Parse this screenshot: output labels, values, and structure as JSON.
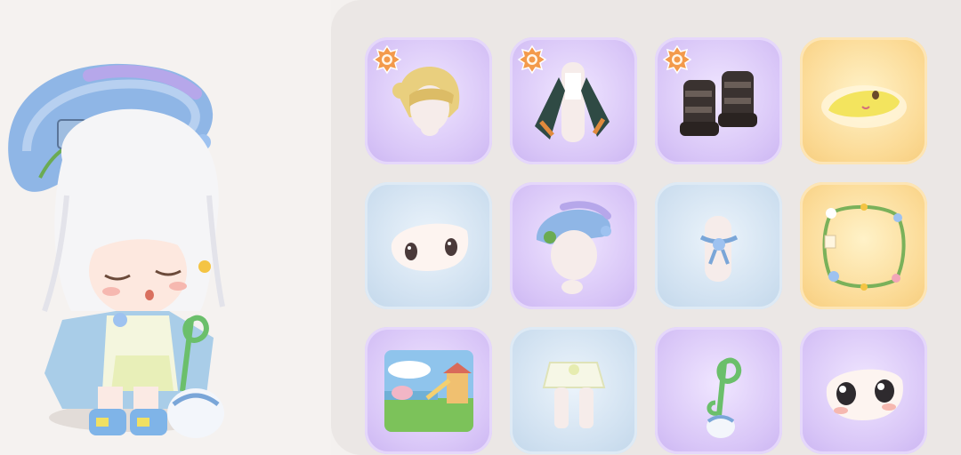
{
  "colors": {
    "slot_purple": "#d8c5f7",
    "slot_blue": "#cfe0f0",
    "slot_gold": "#fbd993",
    "badge_orange": "#f39a4b",
    "panel_bg": "#ebe7e5",
    "page_bg": "#f4f1ef"
  },
  "character": {
    "icon": "chibi-character-avatar"
  },
  "slots": [
    {
      "item": "hair",
      "rarity": "purple",
      "badge": true,
      "icon": "blonde-hair-icon"
    },
    {
      "item": "outfit",
      "rarity": "purple",
      "badge": true,
      "icon": "jacket-outfit-icon"
    },
    {
      "item": "boots",
      "rarity": "purple",
      "badge": true,
      "icon": "black-boots-icon"
    },
    {
      "item": "expression",
      "rarity": "gold",
      "badge": false,
      "icon": "sleepy-face-icon"
    },
    {
      "item": "eyes",
      "rarity": "blue",
      "badge": false,
      "icon": "small-eyes-icon"
    },
    {
      "item": "hat",
      "rarity": "purple",
      "badge": false,
      "icon": "blue-beret-icon"
    },
    {
      "item": "necklace",
      "rarity": "blue",
      "badge": false,
      "icon": "bow-necklace-icon"
    },
    {
      "item": "frame",
      "rarity": "gold",
      "badge": false,
      "icon": "flower-frame-icon"
    },
    {
      "item": "background",
      "rarity": "purple",
      "badge": false,
      "icon": "playground-scene-icon"
    },
    {
      "item": "skirt",
      "rarity": "blue",
      "badge": false,
      "icon": "white-skirt-icon"
    },
    {
      "item": "handheld",
      "rarity": "purple",
      "badge": false,
      "icon": "music-note-wand-icon"
    },
    {
      "item": "eyes",
      "rarity": "purple",
      "badge": false,
      "icon": "big-eyes-icon"
    }
  ]
}
